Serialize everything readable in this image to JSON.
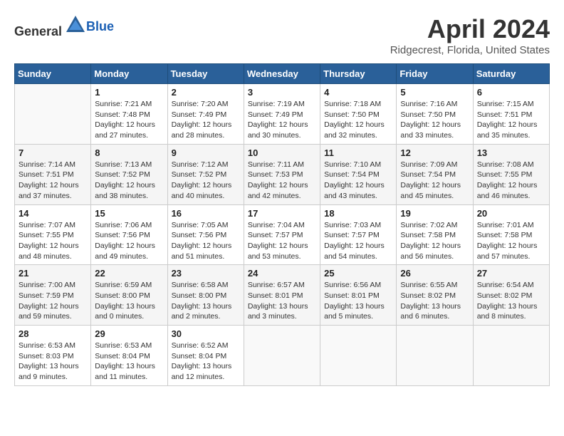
{
  "header": {
    "logo_general": "General",
    "logo_blue": "Blue",
    "title": "April 2024",
    "subtitle": "Ridgecrest, Florida, United States"
  },
  "days_of_week": [
    "Sunday",
    "Monday",
    "Tuesday",
    "Wednesday",
    "Thursday",
    "Friday",
    "Saturday"
  ],
  "weeks": [
    [
      {
        "day": "",
        "info": ""
      },
      {
        "day": "1",
        "info": "Sunrise: 7:21 AM\nSunset: 7:48 PM\nDaylight: 12 hours\nand 27 minutes."
      },
      {
        "day": "2",
        "info": "Sunrise: 7:20 AM\nSunset: 7:49 PM\nDaylight: 12 hours\nand 28 minutes."
      },
      {
        "day": "3",
        "info": "Sunrise: 7:19 AM\nSunset: 7:49 PM\nDaylight: 12 hours\nand 30 minutes."
      },
      {
        "day": "4",
        "info": "Sunrise: 7:18 AM\nSunset: 7:50 PM\nDaylight: 12 hours\nand 32 minutes."
      },
      {
        "day": "5",
        "info": "Sunrise: 7:16 AM\nSunset: 7:50 PM\nDaylight: 12 hours\nand 33 minutes."
      },
      {
        "day": "6",
        "info": "Sunrise: 7:15 AM\nSunset: 7:51 PM\nDaylight: 12 hours\nand 35 minutes."
      }
    ],
    [
      {
        "day": "7",
        "info": "Sunrise: 7:14 AM\nSunset: 7:51 PM\nDaylight: 12 hours\nand 37 minutes."
      },
      {
        "day": "8",
        "info": "Sunrise: 7:13 AM\nSunset: 7:52 PM\nDaylight: 12 hours\nand 38 minutes."
      },
      {
        "day": "9",
        "info": "Sunrise: 7:12 AM\nSunset: 7:52 PM\nDaylight: 12 hours\nand 40 minutes."
      },
      {
        "day": "10",
        "info": "Sunrise: 7:11 AM\nSunset: 7:53 PM\nDaylight: 12 hours\nand 42 minutes."
      },
      {
        "day": "11",
        "info": "Sunrise: 7:10 AM\nSunset: 7:54 PM\nDaylight: 12 hours\nand 43 minutes."
      },
      {
        "day": "12",
        "info": "Sunrise: 7:09 AM\nSunset: 7:54 PM\nDaylight: 12 hours\nand 45 minutes."
      },
      {
        "day": "13",
        "info": "Sunrise: 7:08 AM\nSunset: 7:55 PM\nDaylight: 12 hours\nand 46 minutes."
      }
    ],
    [
      {
        "day": "14",
        "info": "Sunrise: 7:07 AM\nSunset: 7:55 PM\nDaylight: 12 hours\nand 48 minutes."
      },
      {
        "day": "15",
        "info": "Sunrise: 7:06 AM\nSunset: 7:56 PM\nDaylight: 12 hours\nand 49 minutes."
      },
      {
        "day": "16",
        "info": "Sunrise: 7:05 AM\nSunset: 7:56 PM\nDaylight: 12 hours\nand 51 minutes."
      },
      {
        "day": "17",
        "info": "Sunrise: 7:04 AM\nSunset: 7:57 PM\nDaylight: 12 hours\nand 53 minutes."
      },
      {
        "day": "18",
        "info": "Sunrise: 7:03 AM\nSunset: 7:57 PM\nDaylight: 12 hours\nand 54 minutes."
      },
      {
        "day": "19",
        "info": "Sunrise: 7:02 AM\nSunset: 7:58 PM\nDaylight: 12 hours\nand 56 minutes."
      },
      {
        "day": "20",
        "info": "Sunrise: 7:01 AM\nSunset: 7:58 PM\nDaylight: 12 hours\nand 57 minutes."
      }
    ],
    [
      {
        "day": "21",
        "info": "Sunrise: 7:00 AM\nSunset: 7:59 PM\nDaylight: 12 hours\nand 59 minutes."
      },
      {
        "day": "22",
        "info": "Sunrise: 6:59 AM\nSunset: 8:00 PM\nDaylight: 13 hours\nand 0 minutes."
      },
      {
        "day": "23",
        "info": "Sunrise: 6:58 AM\nSunset: 8:00 PM\nDaylight: 13 hours\nand 2 minutes."
      },
      {
        "day": "24",
        "info": "Sunrise: 6:57 AM\nSunset: 8:01 PM\nDaylight: 13 hours\nand 3 minutes."
      },
      {
        "day": "25",
        "info": "Sunrise: 6:56 AM\nSunset: 8:01 PM\nDaylight: 13 hours\nand 5 minutes."
      },
      {
        "day": "26",
        "info": "Sunrise: 6:55 AM\nSunset: 8:02 PM\nDaylight: 13 hours\nand 6 minutes."
      },
      {
        "day": "27",
        "info": "Sunrise: 6:54 AM\nSunset: 8:02 PM\nDaylight: 13 hours\nand 8 minutes."
      }
    ],
    [
      {
        "day": "28",
        "info": "Sunrise: 6:53 AM\nSunset: 8:03 PM\nDaylight: 13 hours\nand 9 minutes."
      },
      {
        "day": "29",
        "info": "Sunrise: 6:53 AM\nSunset: 8:04 PM\nDaylight: 13 hours\nand 11 minutes."
      },
      {
        "day": "30",
        "info": "Sunrise: 6:52 AM\nSunset: 8:04 PM\nDaylight: 13 hours\nand 12 minutes."
      },
      {
        "day": "",
        "info": ""
      },
      {
        "day": "",
        "info": ""
      },
      {
        "day": "",
        "info": ""
      },
      {
        "day": "",
        "info": ""
      }
    ]
  ]
}
